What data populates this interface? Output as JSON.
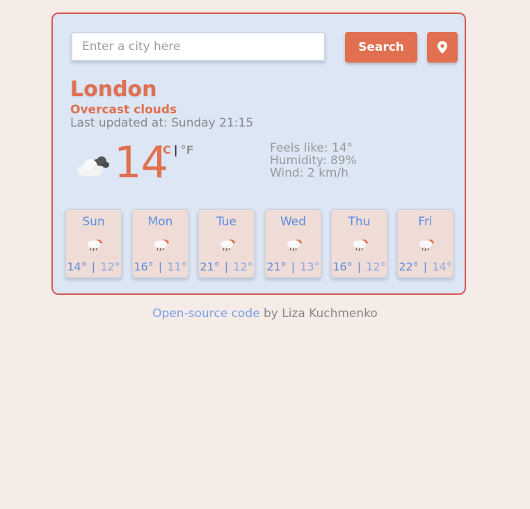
{
  "search": {
    "placeholder": "Enter a city here",
    "value": "",
    "button_label": "Search",
    "location_icon": "map-pin-icon"
  },
  "current": {
    "city": "London",
    "description": "Overcast clouds",
    "updated_label": "Last updated at:",
    "updated_time": "Sunday 21:15",
    "temperature": "14",
    "unit_celsius": "°C",
    "unit_separator": "|",
    "unit_fahrenheit": "°F",
    "icon": "overcast-clouds-icon",
    "feels_like": "Feels like: 14°",
    "humidity": "Humidity: 89%",
    "wind": "Wind: 2 km/h"
  },
  "forecast": [
    {
      "day": "Sun",
      "max": "14°",
      "min": "12°",
      "icon": "rain-icon"
    },
    {
      "day": "Mon",
      "max": "16°",
      "min": "11°",
      "icon": "rain-icon"
    },
    {
      "day": "Tue",
      "max": "21°",
      "min": "12°",
      "icon": "rain-icon"
    },
    {
      "day": "Wed",
      "max": "21°",
      "min": "13°",
      "icon": "rain-icon"
    },
    {
      "day": "Thu",
      "max": "16°",
      "min": "12°",
      "icon": "rain-icon"
    },
    {
      "day": "Fri",
      "max": "22°",
      "min": "14°",
      "icon": "rain-icon"
    }
  ],
  "footer": {
    "link_text": "Open-source code",
    "suffix": " by Liza Kuchmenko"
  },
  "colors": {
    "accent": "#e0704f",
    "card_background": "#dce6f5",
    "card_border": "#d9534f",
    "forecast_text": "#5b8de0",
    "page_background": "#f5ebe7"
  }
}
